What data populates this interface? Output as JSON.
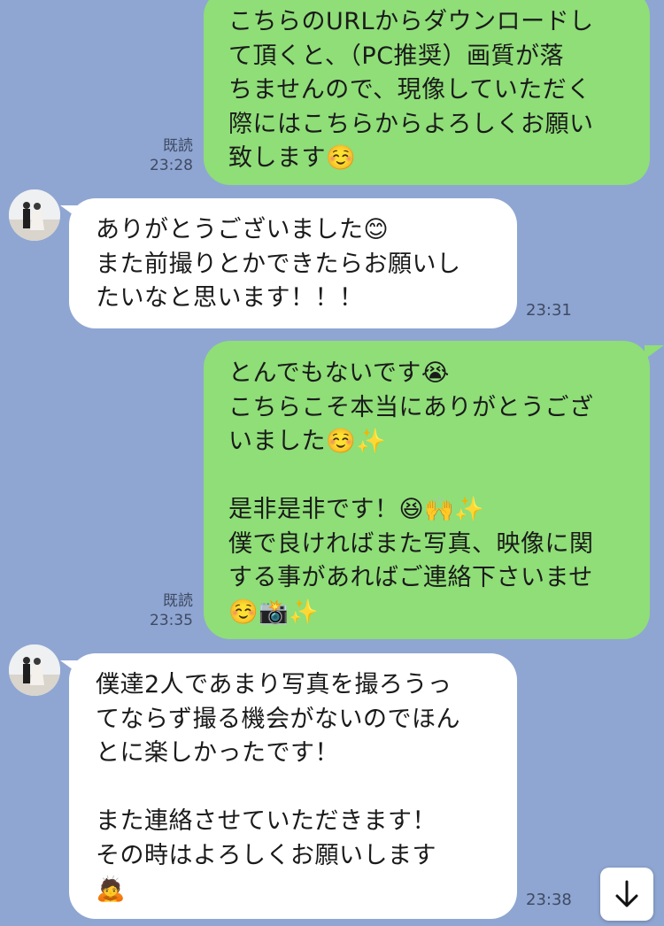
{
  "messages": [
    {
      "direction": "out",
      "text": "こちらのURLからダウンロードし\nて頂くと、（PC推奨）画質が落\nちませんので、現像していただく\n際にはこちらからよろしくお願い\n致します☺️",
      "read": "既読",
      "time": "23:28"
    },
    {
      "direction": "in",
      "text": "ありがとうございました😊\nまた前撮りとかできたらお願いし\nたいなと思います！！！",
      "time": "23:31"
    },
    {
      "direction": "out",
      "text": "とんでもないです😭\nこちらこそ本当にありがとうござ\nいました☺️✨\n\n是非是非です！😆🙌✨\n僕で良ければまた写真、映像に関\nする事があればご連絡下さいませ\n☺️📸✨",
      "read": "既読",
      "time": "23:35"
    },
    {
      "direction": "in",
      "text": "僕達2人であまり写真を撮ろうっ\nてならず撮る機会がないのでほん\nとに楽しかったです！\n\nまた連絡させていただきます！\nその時はよろしくお願いします\n🙇",
      "time": "23:38"
    }
  ],
  "icons": {
    "scroll_down": "arrow-down-icon",
    "avatar": "couple-photo-avatar"
  }
}
